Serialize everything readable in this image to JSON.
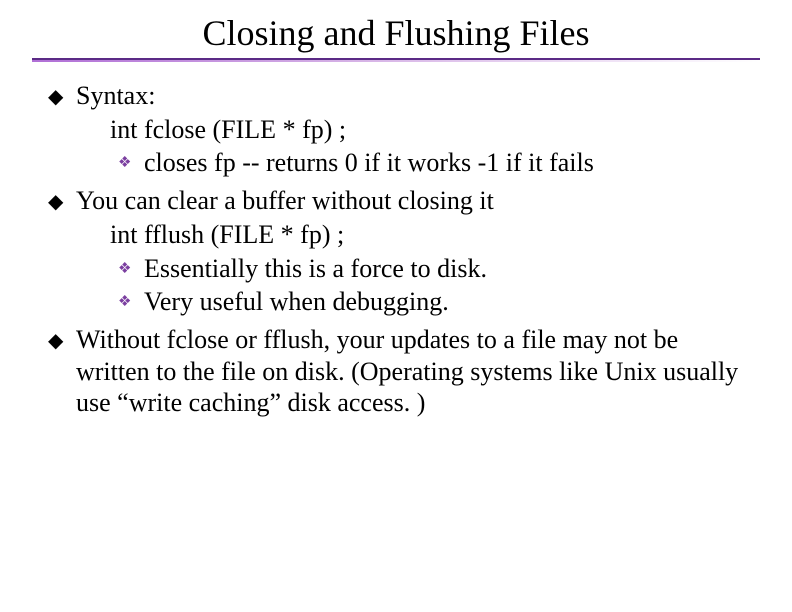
{
  "title": "Closing and Flushing Files",
  "items": [
    {
      "level": 1,
      "text": "Syntax:"
    },
    {
      "level": 2,
      "text": "int fclose (FILE * fp) ;"
    },
    {
      "level": 3,
      "text": "closes fp  -- returns 0 if it works -1 if it fails"
    },
    {
      "level": 1,
      "text": "You can clear a buffer without closing it"
    },
    {
      "level": 2,
      "text": "int fflush (FILE * fp) ;"
    },
    {
      "level": 3,
      "text": "Essentially this is a force to disk."
    },
    {
      "level": 3,
      "text": "Very useful when debugging."
    },
    {
      "level": 1,
      "text": "Without fclose or fflush, your updates to a file may not be written to the file on disk.  (Operating systems like Unix usually use “write caching” disk access. )"
    }
  ],
  "bullets": {
    "lvl1": "◆",
    "lvl3": "❖"
  }
}
